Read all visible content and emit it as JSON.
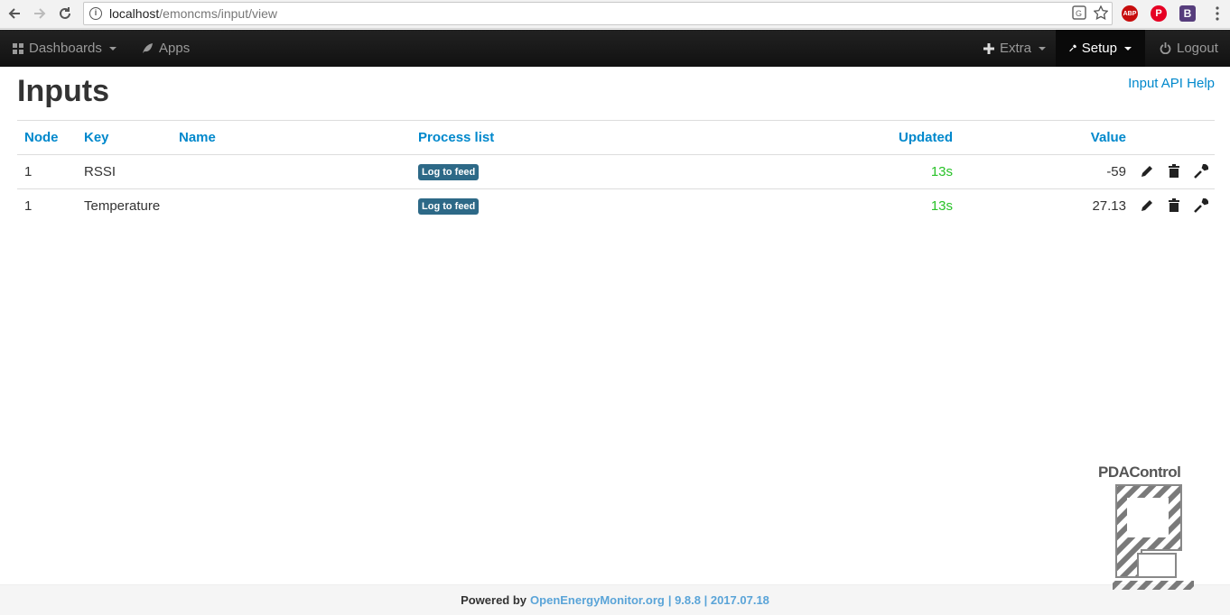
{
  "browser": {
    "url_host": "localhost",
    "url_path": "/emoncms/input/view",
    "extensions": [
      {
        "name": "adblock-plus",
        "label": "ABP",
        "color": "#c70d0d"
      },
      {
        "name": "pinterest",
        "label": "P",
        "color": "#e60023"
      },
      {
        "name": "bootstrap",
        "label": "B",
        "color": "#563d7c"
      }
    ]
  },
  "navbar": {
    "dashboards": "Dashboards",
    "apps": "Apps",
    "extra": "Extra",
    "setup": "Setup",
    "logout": "Logout"
  },
  "page": {
    "title": "Inputs",
    "api_help": "Input API Help"
  },
  "table": {
    "headers": {
      "node": "Node",
      "key": "Key",
      "name": "Name",
      "process_list": "Process list",
      "updated": "Updated",
      "value": "Value"
    },
    "rows": [
      {
        "node": "1",
        "key": "RSSI",
        "name": "",
        "process": "Log to feed",
        "updated": "13s",
        "value": "-59"
      },
      {
        "node": "1",
        "key": "Temperature",
        "name": "",
        "process": "Log to feed",
        "updated": "13s",
        "value": "27.13"
      }
    ]
  },
  "footer": {
    "powered_by": "Powered by",
    "link": "OpenEnergyMonitor.org",
    "version": "| 9.8.8 | 2017.07.18"
  },
  "watermark": {
    "text": "PDAControl"
  },
  "colors": {
    "link": "#0088cc",
    "updated": "#29c229",
    "badge": "#2d6987",
    "navbar": "#1b1b1b"
  }
}
